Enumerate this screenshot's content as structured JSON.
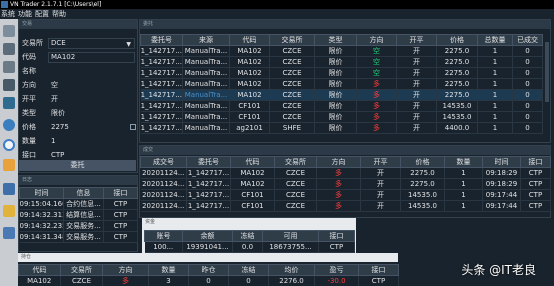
{
  "window": {
    "title": "VN Trader 2.1.7.1 [C:\\Users\\el]"
  },
  "menu": [
    "系统",
    "功能",
    "配置",
    "帮助"
  ],
  "trade_form": {
    "title": "交易",
    "fields": [
      {
        "label": "交易所",
        "value": "DCE"
      },
      {
        "label": "代码",
        "value": "MA102"
      },
      {
        "label": "名称",
        "value": ""
      },
      {
        "label": "方向",
        "value": "空"
      },
      {
        "label": "开平",
        "value": "开"
      },
      {
        "label": "类型",
        "value": "限价"
      },
      {
        "label": "价格",
        "value": "2275"
      },
      {
        "label": "数量",
        "value": "1"
      },
      {
        "label": "接口",
        "value": "CTP"
      }
    ],
    "submit_label": "委托"
  },
  "order_panel": {
    "title": "委托",
    "columns": [
      "委托号",
      "来源",
      "代码",
      "交易所",
      "类型",
      "方向",
      "开平",
      "价格",
      "总数量",
      "已成交"
    ],
    "rows": [
      [
        "1_142717...",
        "ManualTra...",
        "MA102",
        "CZCE",
        "限价",
        "空",
        "开",
        "2275.0",
        "1",
        "0"
      ],
      [
        "1_142717...",
        "ManualTra...",
        "MA102",
        "CZCE",
        "限价",
        "空",
        "开",
        "2275.0",
        "1",
        "0"
      ],
      [
        "1_142717...",
        "ManualTra...",
        "MA102",
        "CZCE",
        "限价",
        "空",
        "开",
        "2275.0",
        "1",
        "0"
      ],
      [
        "1_142717...",
        "ManualTra...",
        "MA102",
        "CZCE",
        "限价",
        "多",
        "开",
        "2275.0",
        "1",
        "0"
      ],
      [
        "1_142717...",
        "ManualTra...",
        "MA102",
        "CZCE",
        "限价",
        "多",
        "开",
        "2275.0",
        "1",
        "0"
      ],
      [
        "1_142717...",
        "ManualTra...",
        "CF101",
        "CZCE",
        "限价",
        "多",
        "开",
        "14535.0",
        "1",
        "0"
      ],
      [
        "1_142717...",
        "ManualTra...",
        "CF101",
        "CZCE",
        "限价",
        "多",
        "开",
        "14535.0",
        "1",
        "0"
      ],
      [
        "1_142717...",
        "ManualTra...",
        "ag2101",
        "SHFE",
        "限价",
        "多",
        "开",
        "4400.0",
        "1",
        "0"
      ]
    ]
  },
  "trade_panel": {
    "title": "成交",
    "columns": [
      "成交号",
      "委托号",
      "代码",
      "交易所",
      "方向",
      "开平",
      "价格",
      "数量",
      "时间",
      "接口"
    ],
    "rows": [
      [
        "20201124...",
        "1_142717...",
        "MA102",
        "CZCE",
        "多",
        "开",
        "2275.0",
        "1",
        "09:18:29",
        "CTP"
      ],
      [
        "20201124...",
        "1_142717...",
        "MA102",
        "CZCE",
        "多",
        "开",
        "2275.0",
        "1",
        "09:18:29",
        "CTP"
      ],
      [
        "20201124...",
        "1_142717...",
        "CF101",
        "CZCE",
        "多",
        "开",
        "14535.0",
        "1",
        "09:17:44",
        "CTP"
      ],
      [
        "20201124...",
        "1_142717...",
        "CF101",
        "CZCE",
        "多",
        "开",
        "14535.0",
        "1",
        "09:17:44",
        "CTP"
      ]
    ]
  },
  "log_panel": {
    "title": "日志",
    "columns": [
      "时间",
      "信息",
      "接口"
    ],
    "rows": [
      [
        "09:15:04.160",
        "合约信息...",
        "CTP"
      ],
      [
        "09:14:32.313",
        "结算信息...",
        "CTP"
      ],
      [
        "09:14:32.235",
        "交易服务...",
        "CTP"
      ],
      [
        "09:14:31.348",
        "交易服务...",
        "CTP"
      ]
    ]
  },
  "account_panel": {
    "title": "资金",
    "columns": [
      "账号",
      "余额",
      "冻结",
      "可用",
      "接口"
    ],
    "rows": [
      [
        "100...",
        "19391041...",
        "0.0",
        "18673755...",
        "CTP"
      ]
    ]
  },
  "position_panel": {
    "title": "持仓",
    "columns": [
      "代码",
      "交易所",
      "方向",
      "数量",
      "昨仓",
      "冻结",
      "均价",
      "盈亏",
      "接口"
    ],
    "rows": [
      [
        "MA102",
        "CZCE",
        "多",
        "3",
        "0",
        "0",
        "2276.0",
        "-30.0",
        "CTP"
      ]
    ]
  },
  "watermark": "头条 @IT老良",
  "colors": {
    "background": "#19232d",
    "long": "#ff3b3b",
    "short": "#1fd17a"
  }
}
